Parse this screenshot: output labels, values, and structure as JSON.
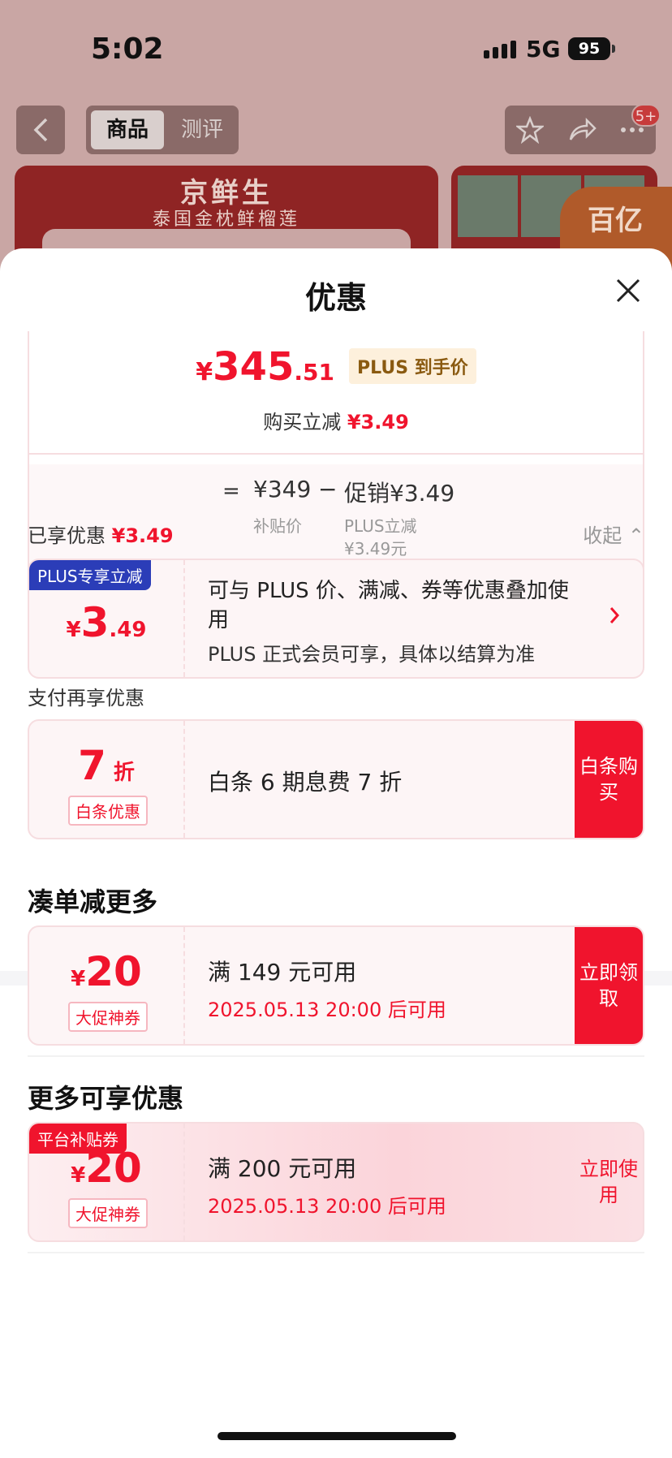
{
  "status": {
    "time": "5:02",
    "network": "5G",
    "battery": "95"
  },
  "nav": {
    "tab_active": "商品",
    "tab_other": "测评",
    "badge": "5+"
  },
  "product": {
    "brand": "京鲜生",
    "subbrand": "泰国金枕鲜榴莲",
    "promo_tag": "百亿"
  },
  "sheet": {
    "title": "优惠"
  },
  "price": {
    "yen": "¥",
    "integer": "345",
    "decimal": ".51",
    "plus_tag": "PLUS 到手价",
    "sub_label": "购买立减 ",
    "sub_value": "¥3.49",
    "eq": "=",
    "base_price": "¥349",
    "minus": "−",
    "promo": "促销¥3.49",
    "base_label": "补贴价",
    "promo_label1": "PLUS立减",
    "promo_label2": "¥3.49元"
  },
  "enjoyed": {
    "label": "已享优惠 ",
    "value": "¥3.49",
    "collapse": "收起 ⌃"
  },
  "plus_coupon": {
    "tag": "PLUS专享立减",
    "yen": "¥",
    "int": "3",
    "dec": ".49",
    "text1": "可与 PLUS 价、满减、券等优惠叠加使用",
    "text2": "PLUS 正式会员可享，具体以结算为准"
  },
  "pay_section": {
    "label": "支付再享优惠"
  },
  "baitiao": {
    "big": "7",
    "unit": " 折",
    "sublabel": "白条优惠",
    "text": "白条 6 期息费 7 折",
    "cta": "白条购买"
  },
  "bundle": {
    "heading": "凑单减更多",
    "yen": "¥",
    "amount": "20",
    "sublabel": "大促神券",
    "condition": "满 149 元可用",
    "date": "2025.05.13 20:00 后可用",
    "cta": "立即领取"
  },
  "more": {
    "heading": "更多可享优惠",
    "tag": "平台补贴券",
    "yen": "¥",
    "amount": "20",
    "sublabel": "大促神券",
    "condition": "满 200 元可用",
    "date": "2025.05.13 20:00 后可用",
    "cta": "立即使用"
  }
}
